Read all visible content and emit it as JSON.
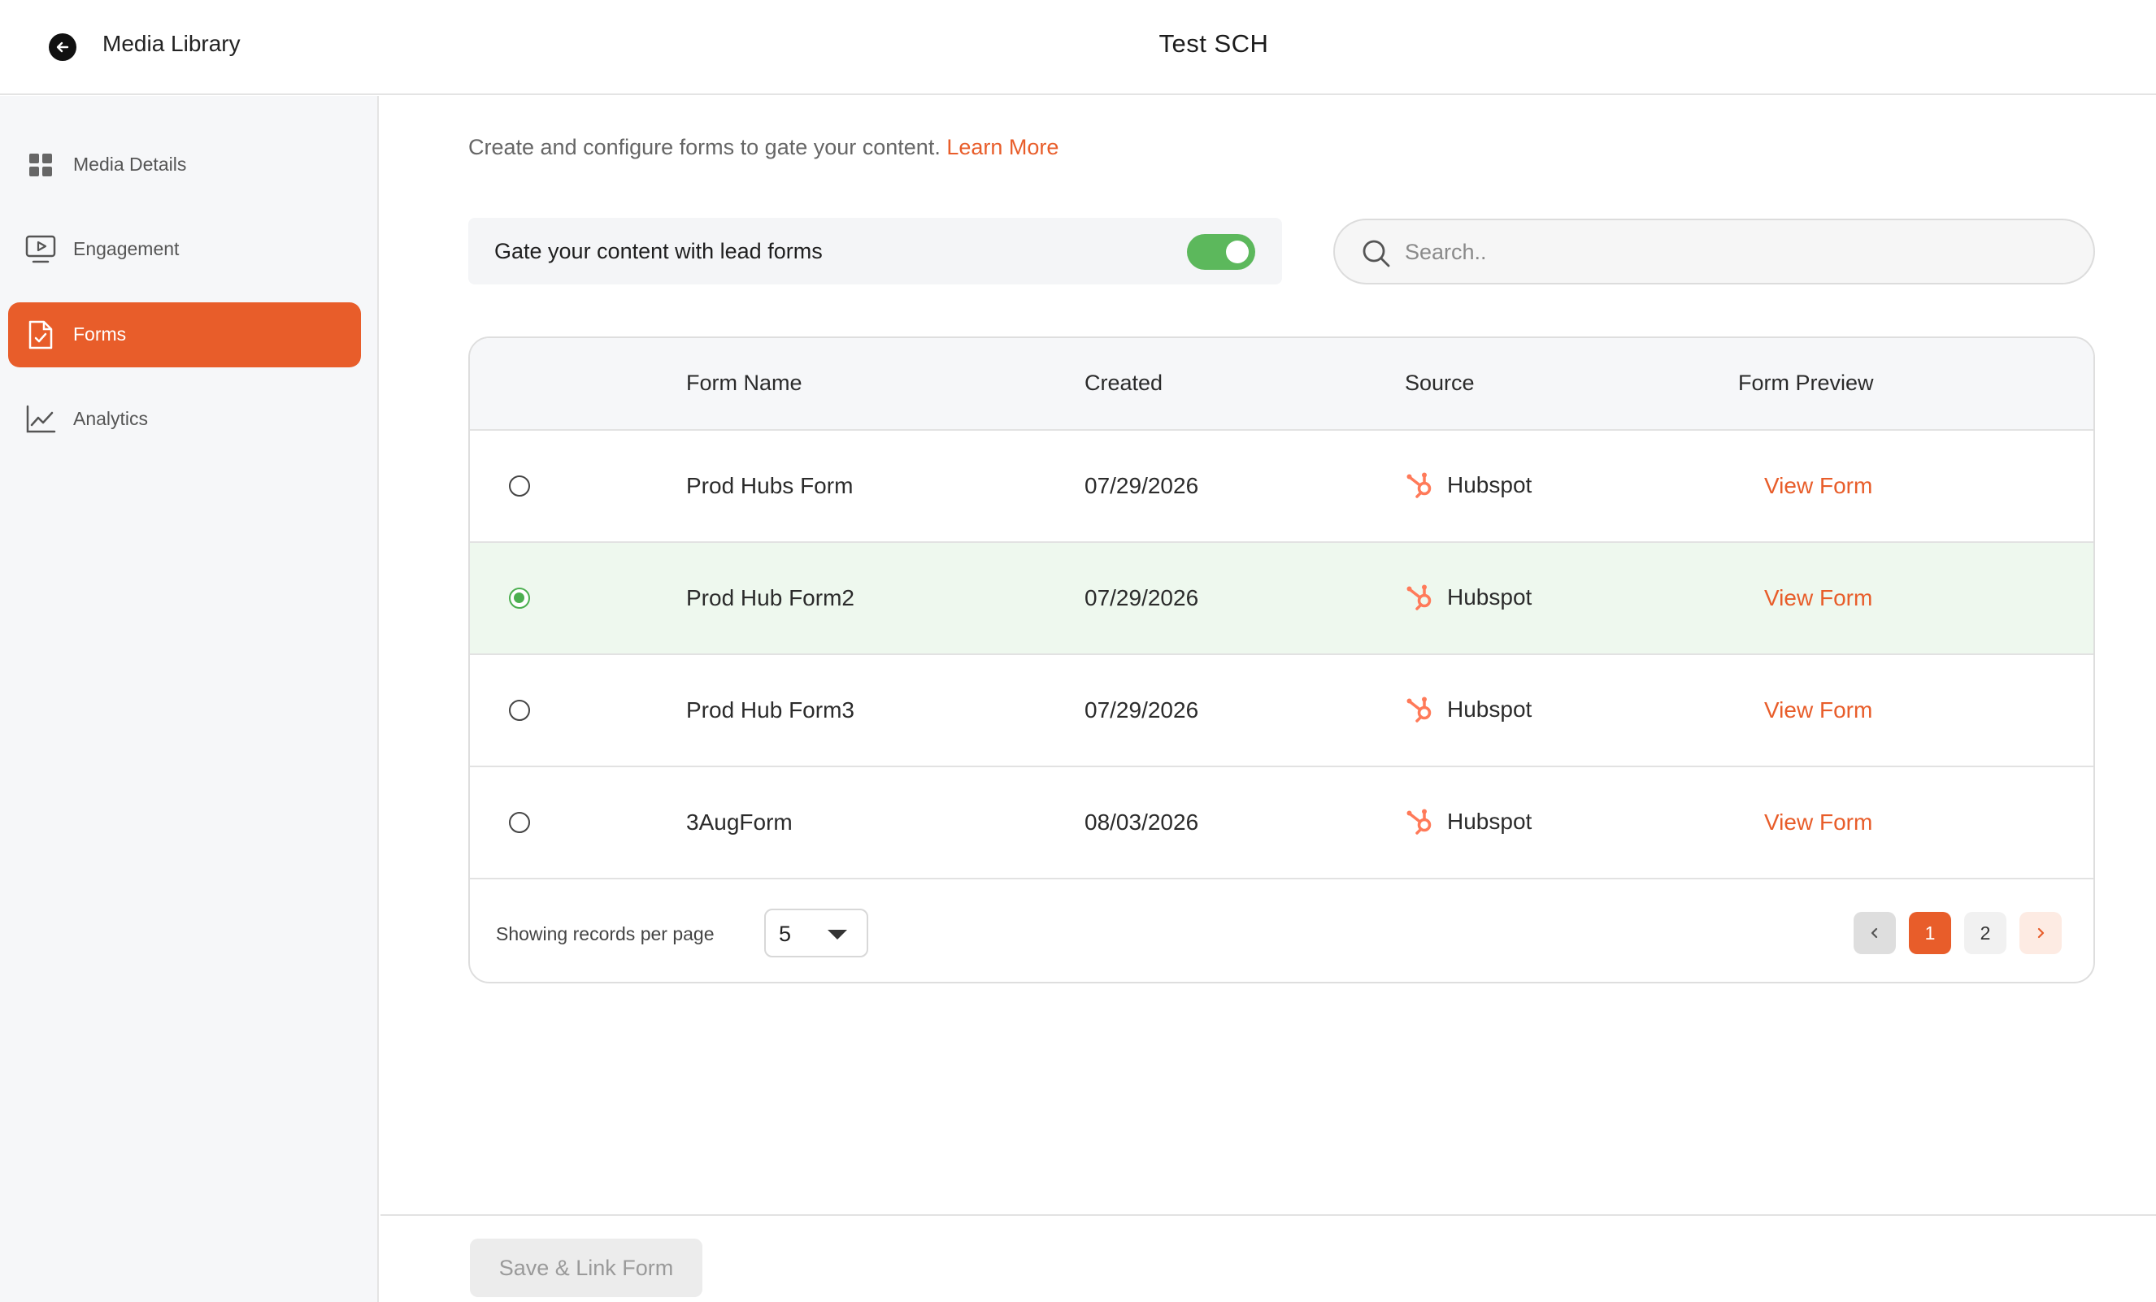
{
  "header": {
    "back_link": "Media Library",
    "title": "Test SCH"
  },
  "sidebar": {
    "items": [
      {
        "label": "Media Details",
        "icon": "grid-icon",
        "active": false
      },
      {
        "label": "Engagement",
        "icon": "monitor-play-icon",
        "active": false
      },
      {
        "label": "Forms",
        "icon": "document-check-icon",
        "active": true
      },
      {
        "label": "Analytics",
        "icon": "line-chart-icon",
        "active": false
      }
    ]
  },
  "main": {
    "intro": "Create and configure forms to gate your content.",
    "learn_more": "Learn More",
    "gate_label": "Gate your content with lead forms",
    "gate_enabled": true,
    "search_placeholder": "Search.."
  },
  "table": {
    "headers": {
      "name": "Form Name",
      "created": "Created",
      "source": "Source",
      "preview": "Form Preview"
    },
    "rows": [
      {
        "name": "Prod Hubs Form",
        "created": "07/29/2026",
        "source": "Hubspot",
        "preview": "View Form",
        "selected": false
      },
      {
        "name": "Prod Hub Form2",
        "created": "07/29/2026",
        "source": "Hubspot",
        "preview": "View Form",
        "selected": true
      },
      {
        "name": "Prod Hub Form3",
        "created": "07/29/2026",
        "source": "Hubspot",
        "preview": "View Form",
        "selected": false
      },
      {
        "name": "3AugForm",
        "created": "08/03/2026",
        "source": "Hubspot",
        "preview": "View Form",
        "selected": false
      }
    ],
    "footer": {
      "per_page_label": "Showing records per page",
      "per_page_value": "5",
      "pages": [
        "1",
        "2"
      ],
      "current_page": "1"
    }
  },
  "actions": {
    "save_label": "Save & Link Form"
  },
  "colors": {
    "accent": "#e85d2a",
    "toggle_on": "#5cb85c",
    "selected_row": "#eef8ee"
  }
}
